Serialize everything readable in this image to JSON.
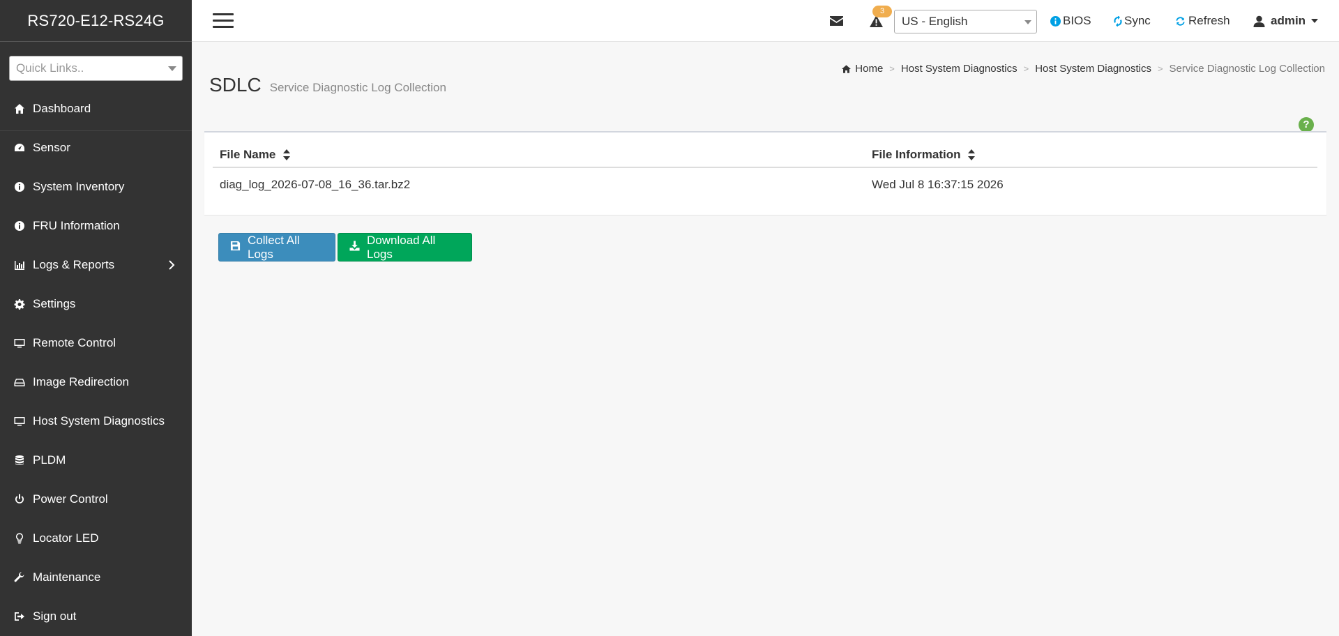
{
  "app": {
    "title": "RS720-E12-RS24G"
  },
  "sidebar": {
    "quick_links_placeholder": "Quick Links..",
    "items": [
      {
        "label": "Dashboard",
        "icon": "home-icon"
      },
      {
        "label": "Sensor",
        "icon": "gauge-icon"
      },
      {
        "label": "System Inventory",
        "icon": "info-icon"
      },
      {
        "label": "FRU Information",
        "icon": "info-icon"
      },
      {
        "label": "Logs & Reports",
        "icon": "bar-chart-icon",
        "has_submenu": true
      },
      {
        "label": "Settings",
        "icon": "gear-icon"
      },
      {
        "label": "Remote Control",
        "icon": "monitor-icon"
      },
      {
        "label": "Image Redirection",
        "icon": "hdd-icon"
      },
      {
        "label": "Host System Diagnostics",
        "icon": "monitor-icon"
      },
      {
        "label": "PLDM",
        "icon": "database-icon"
      },
      {
        "label": "Power Control",
        "icon": "power-icon"
      },
      {
        "label": "Locator LED",
        "icon": "lightbulb-icon"
      },
      {
        "label": "Maintenance",
        "icon": "wrench-icon"
      },
      {
        "label": "Sign out",
        "icon": "sign-out-icon"
      }
    ]
  },
  "header": {
    "alert_count": "3",
    "language": "US - English",
    "bios_label": "BIOS",
    "sync_label": "Sync",
    "refresh_label": "Refresh",
    "user_label": "admin"
  },
  "page": {
    "title": "SDLC",
    "subtitle": "Service Diagnostic Log Collection",
    "breadcrumb": [
      "Home",
      "Host System Diagnostics",
      "Host System Diagnostics",
      "Service Diagnostic Log Collection"
    ]
  },
  "table": {
    "columns": [
      "File Name",
      "File Information"
    ],
    "rows": [
      {
        "file_name": "diag_log_2026-07-08_16_36.tar.bz2",
        "file_info": "Wed Jul 8 16:37:15 2026"
      }
    ]
  },
  "buttons": {
    "collect_label": "Collect All Logs",
    "download_label": "Download All Logs"
  },
  "colors": {
    "sidebar_bg": "#333333",
    "primary": "#3c8dbc",
    "success": "#00a65a",
    "badge": "#f0ad4e",
    "help": "#6ab04c",
    "accent_blue": "#00a0e4"
  }
}
